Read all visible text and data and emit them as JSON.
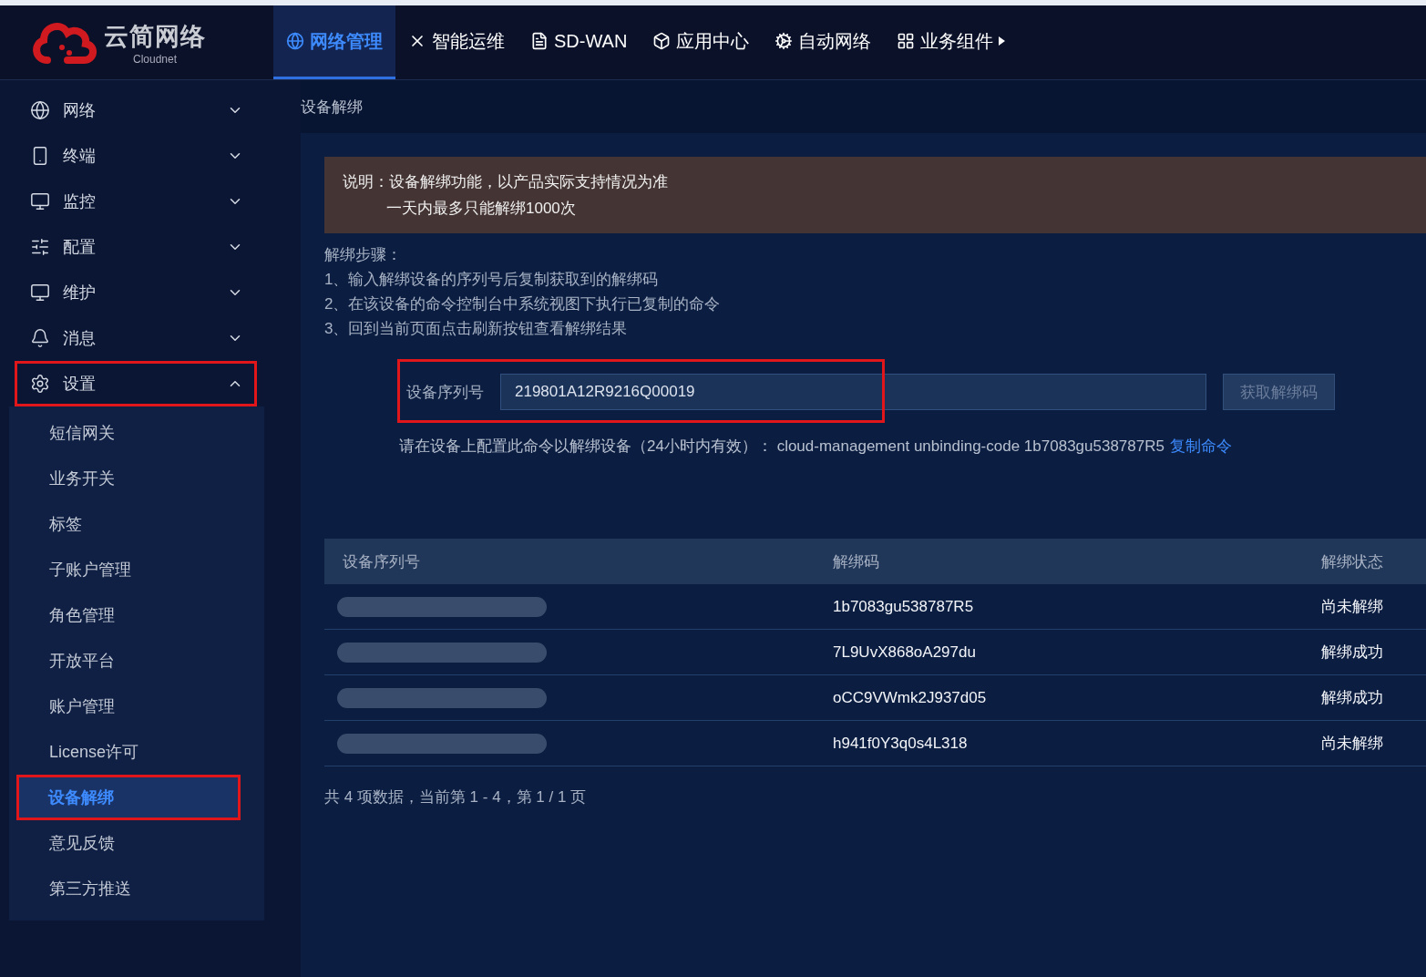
{
  "logo": {
    "name": "云简网络",
    "sub": "Cloudnet"
  },
  "nav": [
    {
      "label": "网络管理",
      "selected": true
    },
    {
      "label": "智能运维",
      "selected": false
    },
    {
      "label": "SD-WAN",
      "selected": false
    },
    {
      "label": "应用中心",
      "selected": false
    },
    {
      "label": "自动网络",
      "selected": false
    },
    {
      "label": "业务组件",
      "selected": false
    }
  ],
  "sidebar": {
    "items": [
      {
        "label": "网络",
        "expanded": false,
        "highlighted": false
      },
      {
        "label": "终端",
        "expanded": false,
        "highlighted": false
      },
      {
        "label": "监控",
        "expanded": false,
        "highlighted": false
      },
      {
        "label": "配置",
        "expanded": false,
        "highlighted": false
      },
      {
        "label": "维护",
        "expanded": false,
        "highlighted": false
      },
      {
        "label": "消息",
        "expanded": false,
        "highlighted": false
      },
      {
        "label": "设置",
        "expanded": true,
        "highlighted": true,
        "children": [
          {
            "label": "短信网关",
            "selected": false,
            "highlighted": false
          },
          {
            "label": "业务开关",
            "selected": false,
            "highlighted": false
          },
          {
            "label": "标签",
            "selected": false,
            "highlighted": false
          },
          {
            "label": "子账户管理",
            "selected": false,
            "highlighted": false
          },
          {
            "label": "角色管理",
            "selected": false,
            "highlighted": false
          },
          {
            "label": "开放平台",
            "selected": false,
            "highlighted": false
          },
          {
            "label": "账户管理",
            "selected": false,
            "highlighted": false
          },
          {
            "label": "License许可",
            "selected": false,
            "highlighted": false
          },
          {
            "label": "设备解绑",
            "selected": true,
            "highlighted": true
          },
          {
            "label": "意见反馈",
            "selected": false,
            "highlighted": false
          },
          {
            "label": "第三方推送",
            "selected": false,
            "highlighted": false
          }
        ]
      }
    ]
  },
  "breadcrumb": "设备解绑",
  "notice": {
    "lines": [
      "说明：设备解绑功能，以产品实际支持情况为准",
      "一天内最多只能解绑1000次"
    ]
  },
  "steps": {
    "title": "解绑步骤：",
    "items": [
      "1、输入解绑设备的序列号后复制获取到的解绑码",
      "2、在该设备的命令控制台中系统视图下执行已复制的命令",
      "3、回到当前页面点击刷新按钮查看解绑结果"
    ]
  },
  "form": {
    "label": "设备序列号",
    "value": "219801A12R9216Q00019",
    "highlighted": true,
    "button": "获取解绑码",
    "button_disabled": true
  },
  "command": {
    "text": "请在设备上配置此命令以解绑设备（24小时内有效）： cloud-management unbinding-code 1b7083gu538787R5",
    "link": "复制命令"
  },
  "table": {
    "columns": [
      "设备序列号",
      "解绑码",
      "解绑状态"
    ],
    "rows": [
      {
        "code": "1b7083gu538787R5",
        "status": "尚未解绑"
      },
      {
        "code": "7L9UvX868oA297du",
        "status": "解绑成功"
      },
      {
        "code": "oCC9VWmk2J937d05",
        "status": "解绑成功"
      },
      {
        "code": "h941f0Y3q0s4L318",
        "status": "尚未解绑"
      }
    ]
  },
  "pagination": "共 4 项数据，当前第 1 - 4，第 1 / 1 页"
}
